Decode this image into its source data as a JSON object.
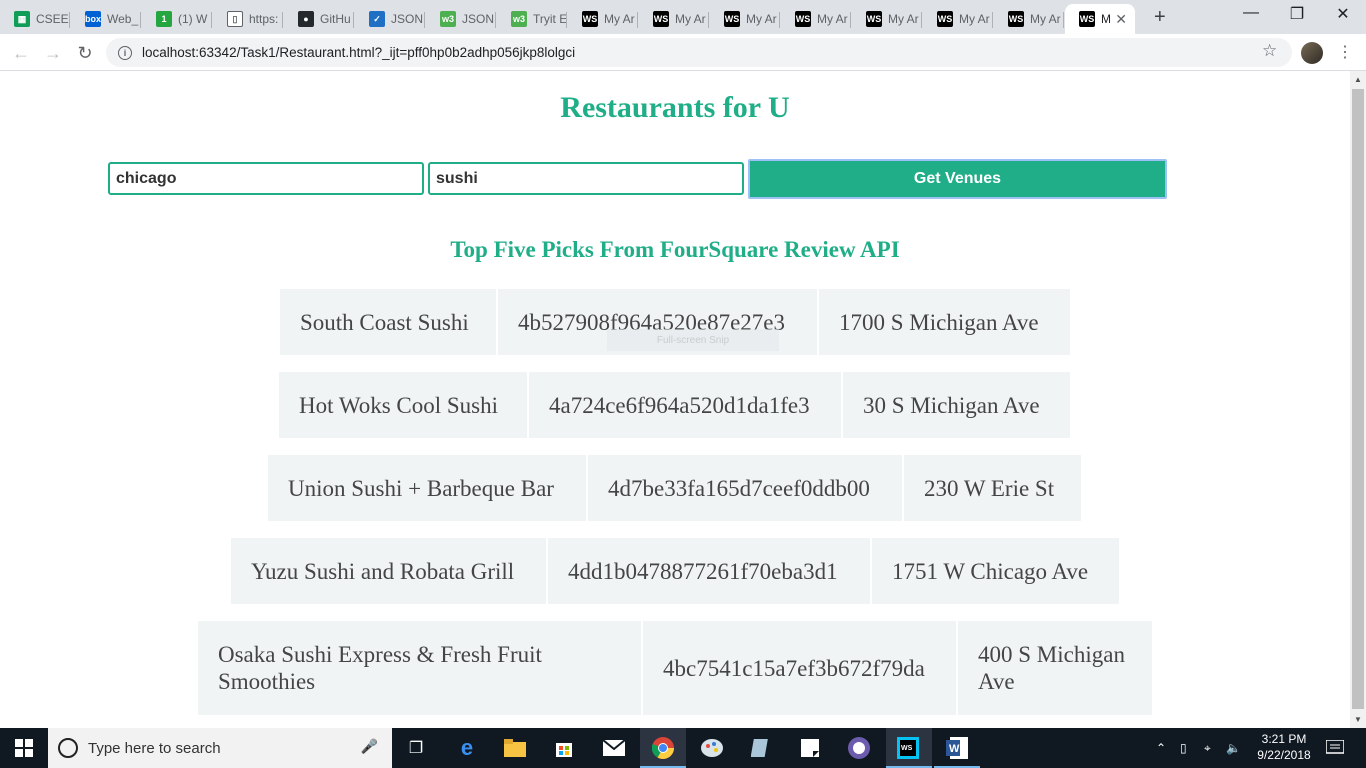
{
  "browser": {
    "tabs": [
      {
        "label": "CSEE",
        "favicon": "sheets-icon",
        "color": "#0f9d58"
      },
      {
        "label": "Web_",
        "favicon": "box-icon",
        "color": "#0061d5"
      },
      {
        "label": "(1) W",
        "favicon": "one-icon",
        "color": "#26a641"
      },
      {
        "label": "https:",
        "favicon": "page-icon",
        "color": "#ffffff"
      },
      {
        "label": "GitHu",
        "favicon": "github-icon",
        "color": "#24292e"
      },
      {
        "label": "JSON",
        "favicon": "check-icon",
        "color": "#1f6fc5"
      },
      {
        "label": "JSON",
        "favicon": "w3-icon",
        "color": "#4caf50"
      },
      {
        "label": "Tryit E",
        "favicon": "w3-icon",
        "color": "#4caf50"
      },
      {
        "label": "My Ar",
        "favicon": "ws-icon",
        "color": "#000000"
      },
      {
        "label": "My Ar",
        "favicon": "ws-icon",
        "color": "#000000"
      },
      {
        "label": "My Ar",
        "favicon": "ws-icon",
        "color": "#000000"
      },
      {
        "label": "My Ar",
        "favicon": "ws-icon",
        "color": "#000000"
      },
      {
        "label": "My Ar",
        "favicon": "ws-icon",
        "color": "#000000"
      },
      {
        "label": "My Ar",
        "favicon": "ws-icon",
        "color": "#000000"
      },
      {
        "label": "My Ar",
        "favicon": "ws-icon",
        "color": "#000000"
      },
      {
        "label": "M",
        "favicon": "ws-icon",
        "color": "#000000",
        "active": true
      }
    ],
    "url": "localhost:63342/Task1/Restaurant.html?_ijt=pff0hp0b2adhp056jkp8lolgci"
  },
  "page": {
    "title": "Restaurants for U",
    "city_input": {
      "value": "chicago"
    },
    "query_input": {
      "value": "sushi"
    },
    "get_button_label": "Get Venues",
    "subtitle": "Top Five Picks From FourSquare Review API",
    "snip_overlay": "Full-screen Snip",
    "venues": [
      {
        "name": "South Coast Sushi",
        "id": "4b527908f964a520e87e27e3",
        "address": "1700 S Michigan Ave"
      },
      {
        "name": "Hot Woks Cool Sushi",
        "id": "4a724ce6f964a520d1da1fe3",
        "address": "30 S Michigan Ave"
      },
      {
        "name": "Union Sushi + Barbeque Bar",
        "id": "4d7be33fa165d7ceef0ddb00",
        "address": "230 W Erie St"
      },
      {
        "name": "Yuzu Sushi and Robata Grill",
        "id": "4dd1b0478877261f70eba3d1",
        "address": "1751 W Chicago Ave"
      },
      {
        "name": "Osaka Sushi Express & Fresh Fruit Smoothies",
        "id": "4bc7541c15a7ef3b672f79da",
        "address": "400 S Michigan Ave"
      }
    ]
  },
  "taskbar": {
    "search_placeholder": "Type here to search",
    "time": "3:21 PM",
    "date": "9/22/2018"
  },
  "colors": {
    "accent": "#1fae87",
    "cell_bg": "#f1f4f5"
  }
}
